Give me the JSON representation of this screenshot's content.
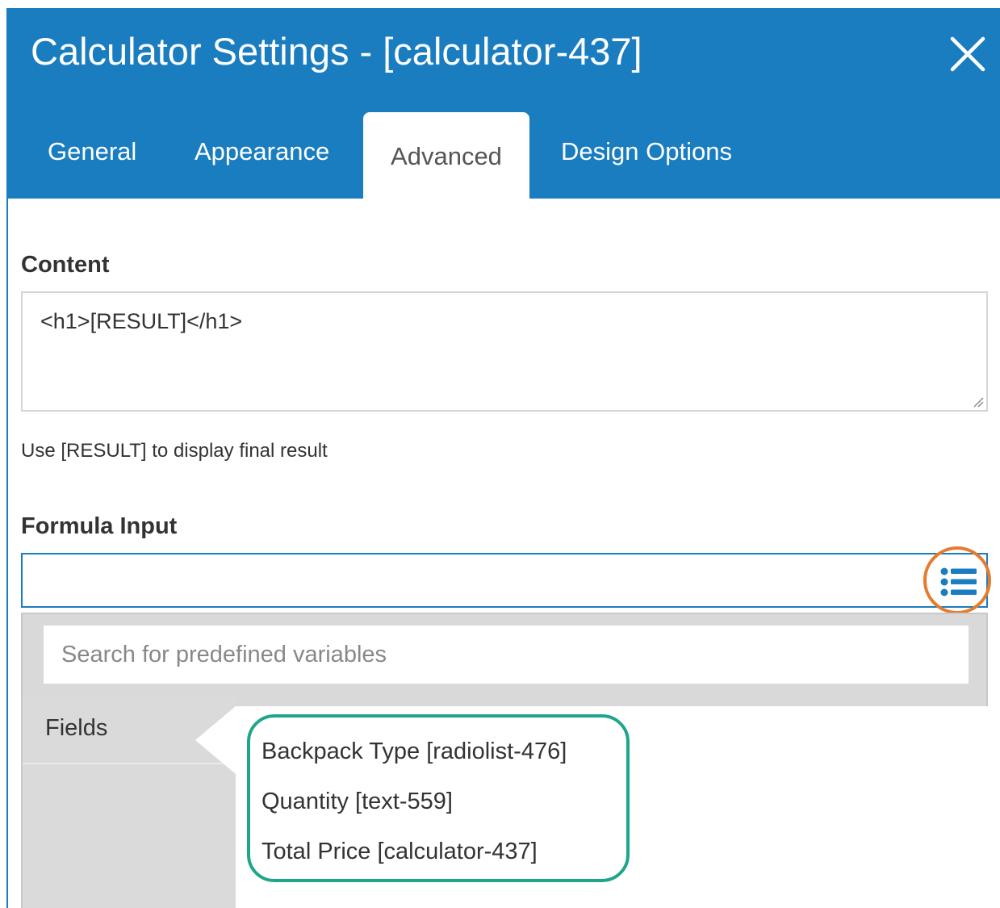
{
  "dialog": {
    "title": "Calculator Settings - [calculator-437]",
    "close_icon": "close-icon",
    "accent_color": "#1a7dc0"
  },
  "tabs": [
    {
      "label": "General",
      "active": false
    },
    {
      "label": "Appearance",
      "active": false
    },
    {
      "label": "Advanced",
      "active": true
    },
    {
      "label": "Design Options",
      "active": false
    }
  ],
  "content": {
    "label": "Content",
    "value": "<h1>[RESULT]</h1>",
    "hint": "Use [RESULT] to display final result"
  },
  "formula": {
    "label": "Formula Input",
    "value": "",
    "list_icon": "list-icon",
    "highlight_color": "#e57b2d"
  },
  "dropdown": {
    "search_placeholder": "Search for predefined variables",
    "categories": [
      {
        "label": "Fields",
        "active": true
      }
    ],
    "variables": [
      "Backpack Type [radiolist-476]",
      "Quantity [text-559]",
      "Total Price [calculator-437]"
    ],
    "highlight_color": "#1fa68a"
  }
}
